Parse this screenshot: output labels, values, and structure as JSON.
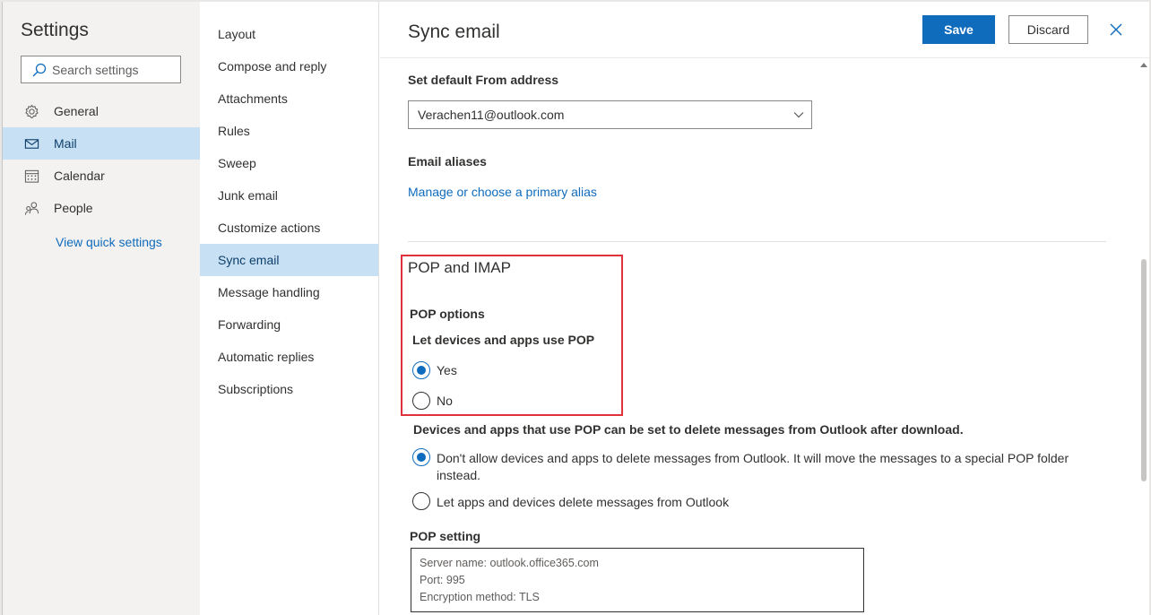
{
  "left": {
    "title": "Settings",
    "search_placeholder": "Search settings",
    "nav": [
      {
        "label": "General",
        "icon": "gear-icon"
      },
      {
        "label": "Mail",
        "icon": "mail-icon"
      },
      {
        "label": "Calendar",
        "icon": "calendar-icon"
      },
      {
        "label": "People",
        "icon": "people-icon"
      }
    ],
    "quick_settings": "View quick settings"
  },
  "middle": {
    "items": [
      "Layout",
      "Compose and reply",
      "Attachments",
      "Rules",
      "Sweep",
      "Junk email",
      "Customize actions",
      "Sync email",
      "Message handling",
      "Forwarding",
      "Automatic replies",
      "Subscriptions"
    ]
  },
  "right": {
    "title": "Sync email",
    "save_label": "Save",
    "discard_label": "Discard",
    "default_from_label": "Set default From address",
    "default_from_value": "Verachen11@outlook.com",
    "aliases_label": "Email aliases",
    "aliases_link": "Manage or choose a primary alias",
    "pop_imap_title": "POP and IMAP",
    "pop_options_label": "POP options",
    "let_devices_label": "Let devices and apps use POP",
    "pop_yes": "Yes",
    "pop_no": "No",
    "delete_desc": "Devices and apps that use POP can be set to delete messages from Outlook after download.",
    "dont_allow_line1": "Don't allow devices and apps to delete messages from Outlook. It will move the messages to a special POP folder",
    "dont_allow_line2": "instead.",
    "let_delete": "Let apps and devices delete messages from Outlook",
    "pop_setting_label": "POP setting",
    "pop_server": "Server name: outlook.office365.com",
    "pop_port": "Port: 995",
    "pop_encryption": "Encryption method: TLS"
  },
  "colors": {
    "accent": "#0f6cbd",
    "selected_bg": "#c7e0f4",
    "highlight_border": "#e0323a"
  }
}
